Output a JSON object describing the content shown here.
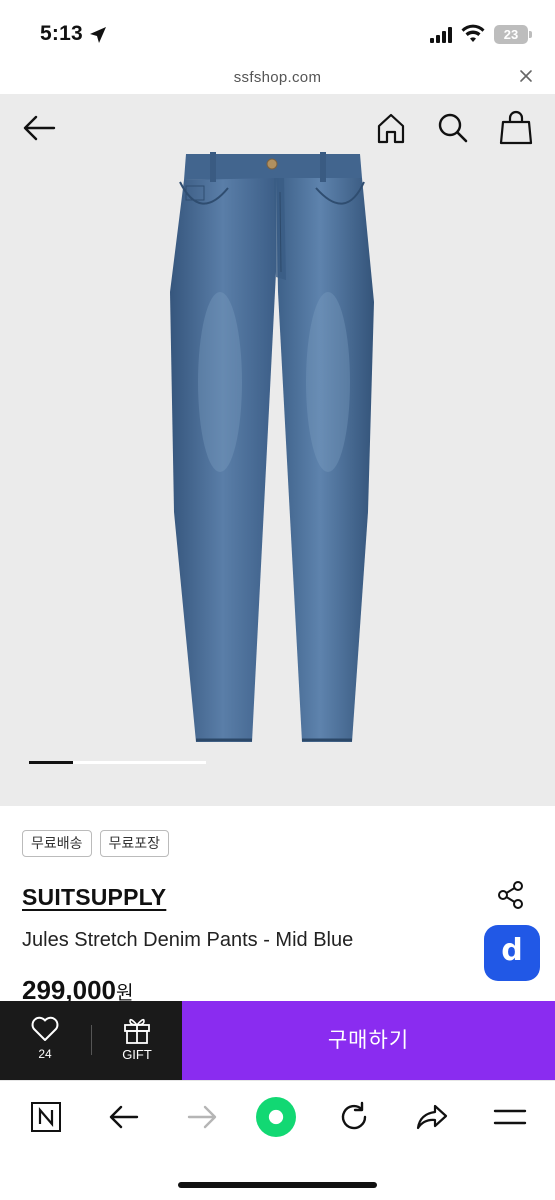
{
  "status_bar": {
    "time": "5:13",
    "battery": "23"
  },
  "browser": {
    "url": "ssfshop.com"
  },
  "product": {
    "tags": [
      "무료배송",
      "무료포장"
    ],
    "brand": "SUITSUPPLY",
    "name": "Jules Stretch Denim Pants - Mid Blue",
    "price": "299,000",
    "price_unit": "원",
    "app_badge": "d"
  },
  "purchase_bar": {
    "like_count": "24",
    "gift_label": "GIFT",
    "buy_label": "구매하기"
  },
  "gallery": {
    "current_slide_fraction": 0.25
  },
  "colors": {
    "buy_button": "#8a2cf0",
    "app_badge": "#2158e6",
    "denim": "#4a6f98",
    "image_bg": "#ebebeb"
  }
}
